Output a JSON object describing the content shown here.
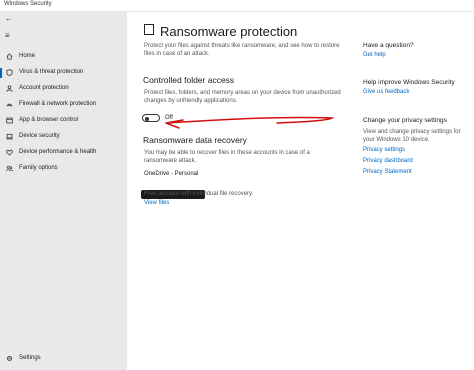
{
  "window": {
    "title": "Windows Security"
  },
  "sidebar": {
    "items": [
      {
        "label": "Home"
      },
      {
        "label": "Virus & threat protection"
      },
      {
        "label": "Account protection"
      },
      {
        "label": "Firewall & network protection"
      },
      {
        "label": "App & browser control"
      },
      {
        "label": "Device security"
      },
      {
        "label": "Device performance & health"
      },
      {
        "label": "Family options"
      }
    ],
    "settings_label": "Settings"
  },
  "main": {
    "title": "Ransomware protection",
    "intro": "Protect your files against threats like ransomware, and see how to restore files in case of an attack.",
    "cfa": {
      "heading": "Controlled folder access",
      "desc": "Protect files, folders, and memory areas on your device from unauthorized changes by unfriendly applications.",
      "toggle_state": "Off"
    },
    "recovery": {
      "heading": "Ransomware data recovery",
      "desc": "You may be able to recover files in these accounts in case of a ransomware attack.",
      "account_name": "OneDrive - Personal",
      "account_desc": "Free account with individual file recovery.",
      "view_files": "View files"
    }
  },
  "right": {
    "question_heading": "Have a question?",
    "get_help": "Get help",
    "improve_heading": "Help improve Windows Security",
    "feedback": "Give us feedback",
    "privacy_heading": "Change your privacy settings",
    "privacy_desc": "View and change privacy settings for your Windows 10 device.",
    "privacy_settings": "Privacy settings",
    "privacy_dashboard": "Privacy dashboard",
    "privacy_statement": "Privacy Statement"
  },
  "colors": {
    "accent": "#0067c0",
    "annotation": "#d01010",
    "sidebar": "#e9e9e9"
  }
}
